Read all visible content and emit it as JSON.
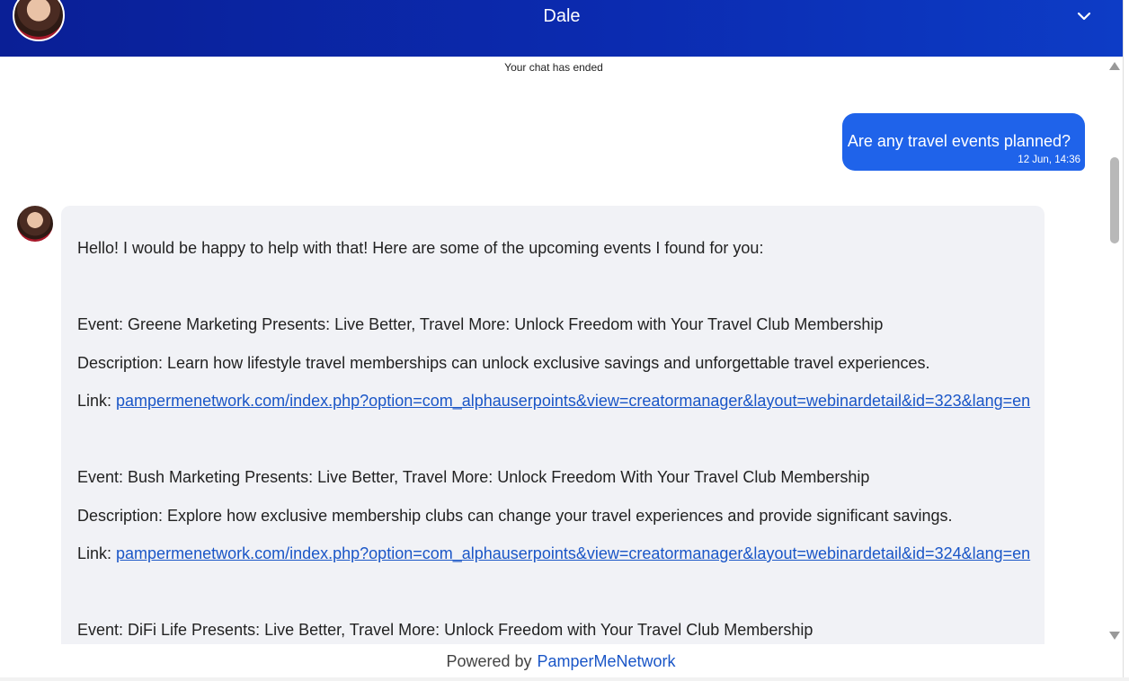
{
  "header": {
    "title": "Dale",
    "collapse_icon": "chevron-down-icon"
  },
  "chat": {
    "status": "Your chat has ended",
    "user_message": {
      "text": "Are any travel events planned?",
      "time": "12 Jun, 14:36"
    },
    "bot_message": {
      "intro": "Hello! I would be happy to help with that! Here are some of the upcoming events I found for you:",
      "events": [
        {
          "event": "Event: Greene Marketing Presents: Live Better, Travel More: Unlock Freedom with Your Travel Club Membership",
          "description": "Description: Learn how lifestyle travel memberships can unlock exclusive savings and unforgettable travel experiences.",
          "link_label": "Link: ",
          "link": "pampermenetwork.com/index.php?option=com_alphauserpoints&view=creatormanager&layout=webinardetail&id=323&lang=en"
        },
        {
          "event": "Event: Bush Marketing Presents: Live Better, Travel More: Unlock Freedom With Your Travel Club Membership",
          "description": "Description: Explore how exclusive membership clubs can change your travel experiences and provide significant savings.",
          "link_label": "Link: ",
          "link": "pampermenetwork.com/index.php?option=com_alphauserpoints&view=creatormanager&layout=webinardetail&id=324&lang=en"
        },
        {
          "event": "Event: DiFi Life Presents: Live Better, Travel More: Unlock Freedom with Your Travel Club Membership"
        }
      ]
    }
  },
  "footer": {
    "powered_by": "Powered by",
    "brand": "PamperMeNetwork"
  }
}
